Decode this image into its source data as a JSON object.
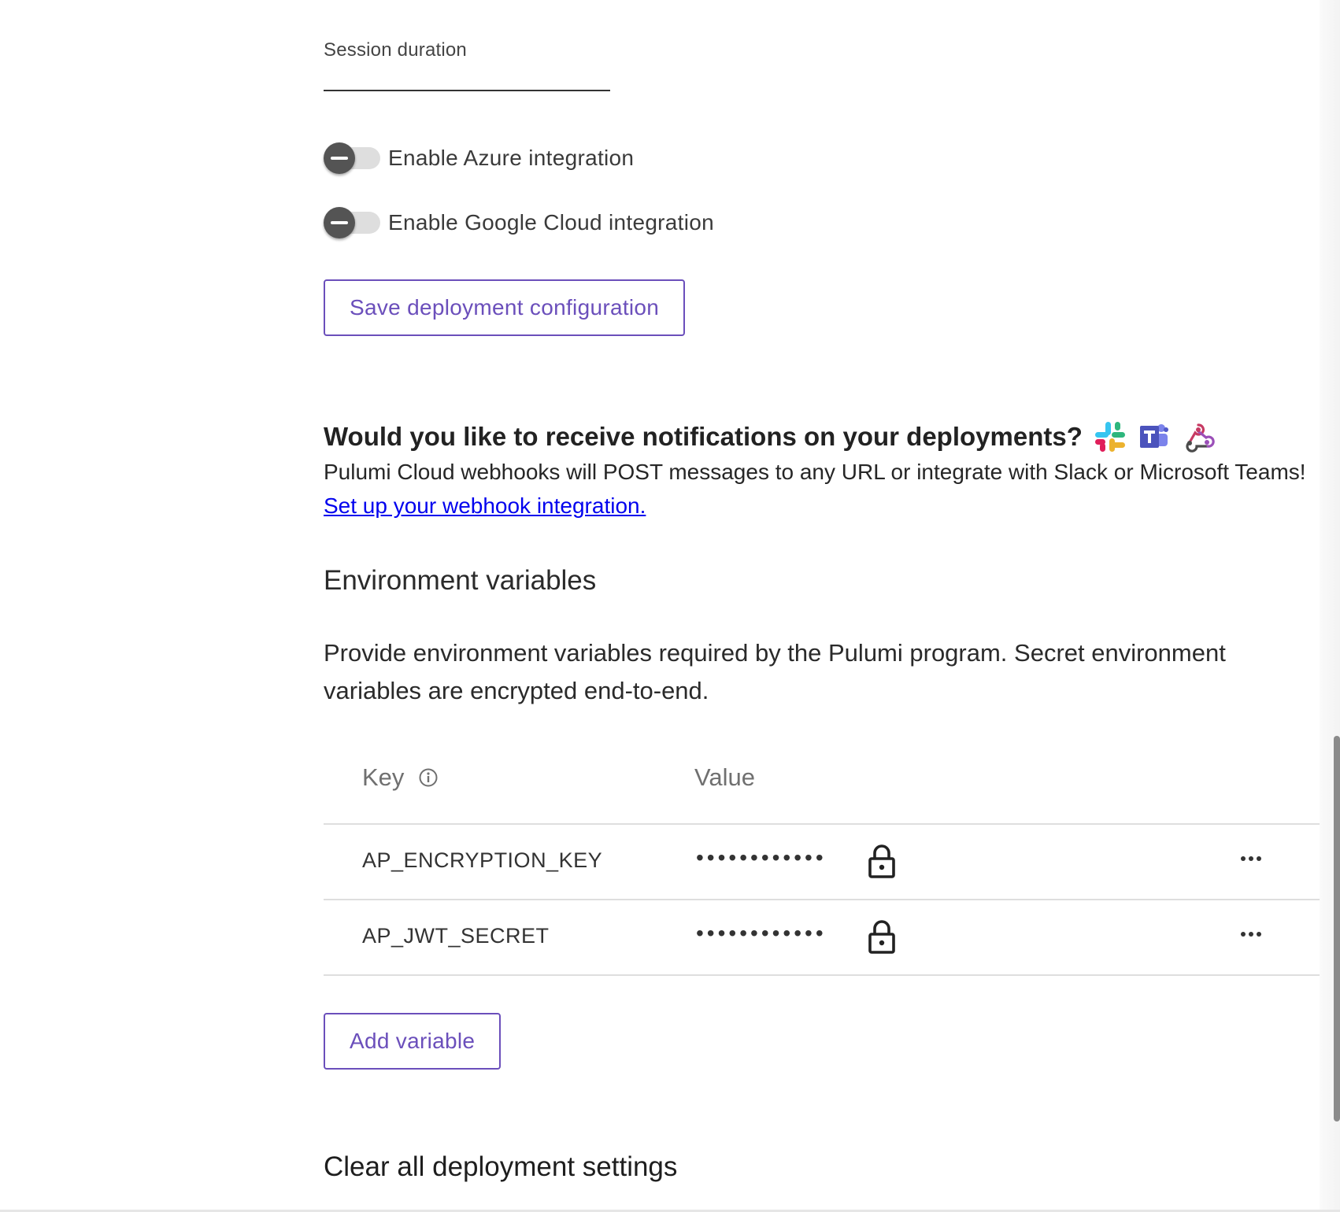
{
  "session": {
    "label": "Session duration",
    "value": ""
  },
  "integrations": [
    {
      "label": "Enable Azure integration",
      "enabled": false
    },
    {
      "label": "Enable Google Cloud integration",
      "enabled": false
    }
  ],
  "save_button_label": "Save deployment configuration",
  "notifications": {
    "heading": "Would you like to receive notifications on your deployments?",
    "icons": [
      "slack-icon",
      "microsoft-teams-icon",
      "webhook-icon"
    ],
    "text": "Pulumi Cloud webhooks will POST messages to any URL or integrate with Slack or Microsoft Teams!",
    "link_text": "Set up your webhook integration."
  },
  "env": {
    "heading": "Environment variables",
    "description": "Provide environment variables required by the Pulumi program. Secret environment variables are encrypted end-to-end.",
    "columns": {
      "key": "Key",
      "value": "Value"
    },
    "rows": [
      {
        "key": "AP_ENCRYPTION_KEY",
        "value": "••••••••••••",
        "secret": true
      },
      {
        "key": "AP_JWT_SECRET",
        "value": "••••••••••••",
        "secret": true
      }
    ],
    "add_button_label": "Add variable"
  },
  "clear_heading": "Clear all deployment settings",
  "colors": {
    "accent": "#6b4fbb",
    "link": "#0000ee",
    "toggle_knob": "#545454",
    "toggle_track": "#dedede"
  }
}
